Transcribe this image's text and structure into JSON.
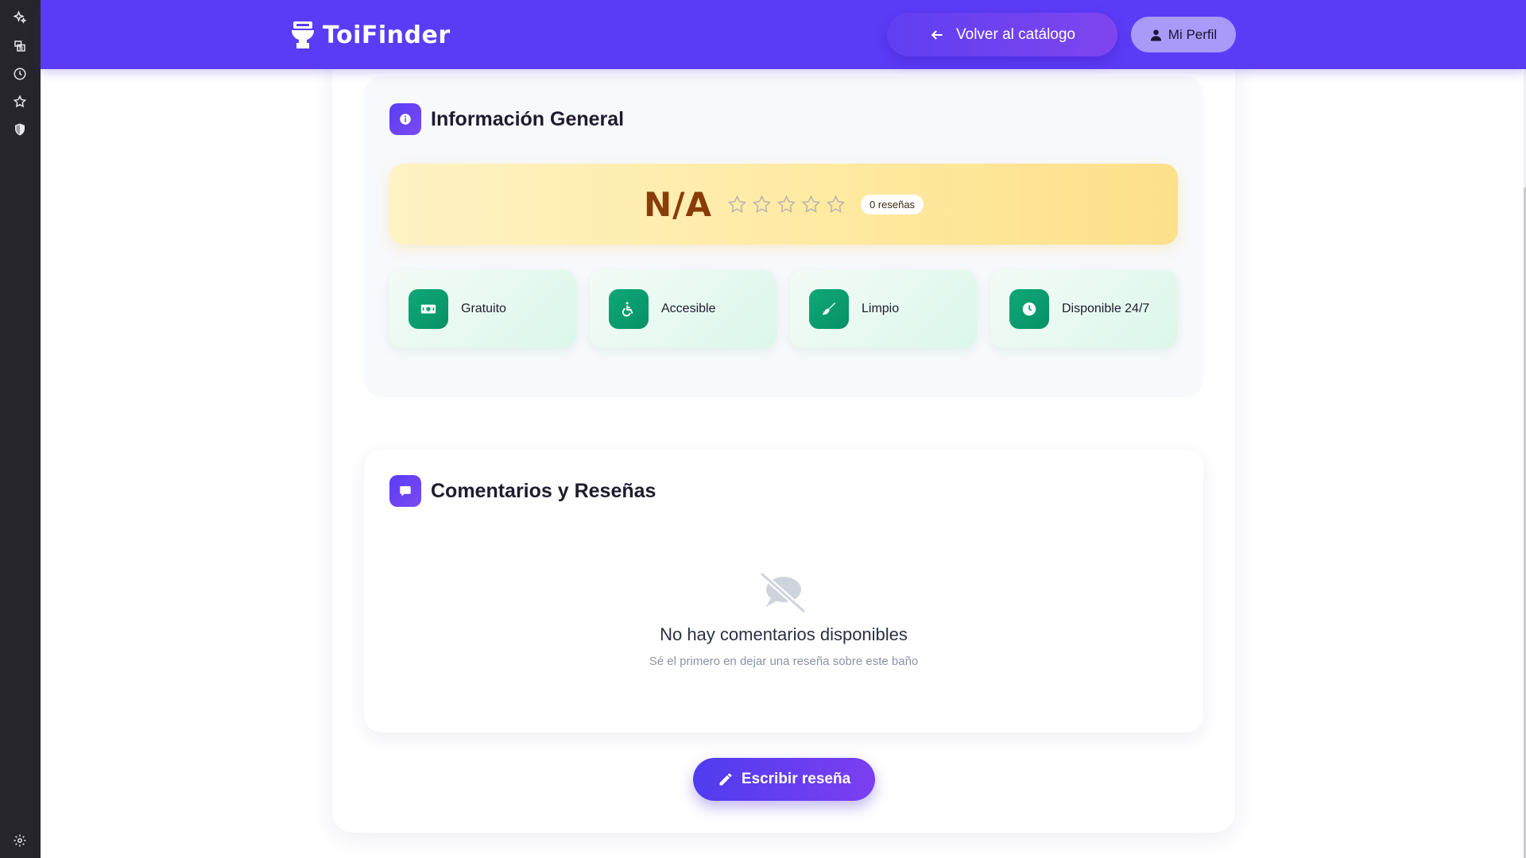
{
  "app": {
    "name": "ToiFinder"
  },
  "rail": {
    "icons": [
      "sparkle-icon",
      "library-icon",
      "history-icon",
      "star-icon",
      "shield-icon",
      "gear-icon"
    ]
  },
  "header": {
    "back_label": "Volver al catálogo",
    "profile_label": "Mi Perfil"
  },
  "info": {
    "title": "Información General",
    "rating_value": "N/A",
    "stars_filled": 0,
    "stars_total": 5,
    "reviews_count": "0 reseñas",
    "features": [
      {
        "label": "Gratuito",
        "icon": "money-icon"
      },
      {
        "label": "Accesible",
        "icon": "wheelchair-icon"
      },
      {
        "label": "Limpio",
        "icon": "broom-icon"
      },
      {
        "label": "Disponible 24/7",
        "icon": "clock-icon"
      }
    ]
  },
  "comments": {
    "title": "Comentarios y Reseñas",
    "empty_title": "No hay comentarios disponibles",
    "empty_subtitle": "Sé el primero en dejar una reseña sobre este baño"
  },
  "actions": {
    "write_review": "Escribir reseña"
  },
  "colors": {
    "primary": "#5b3cf6",
    "success": "#0fa877",
    "rating_text": "#8a3b0a",
    "rail_bg": "#25252b"
  }
}
